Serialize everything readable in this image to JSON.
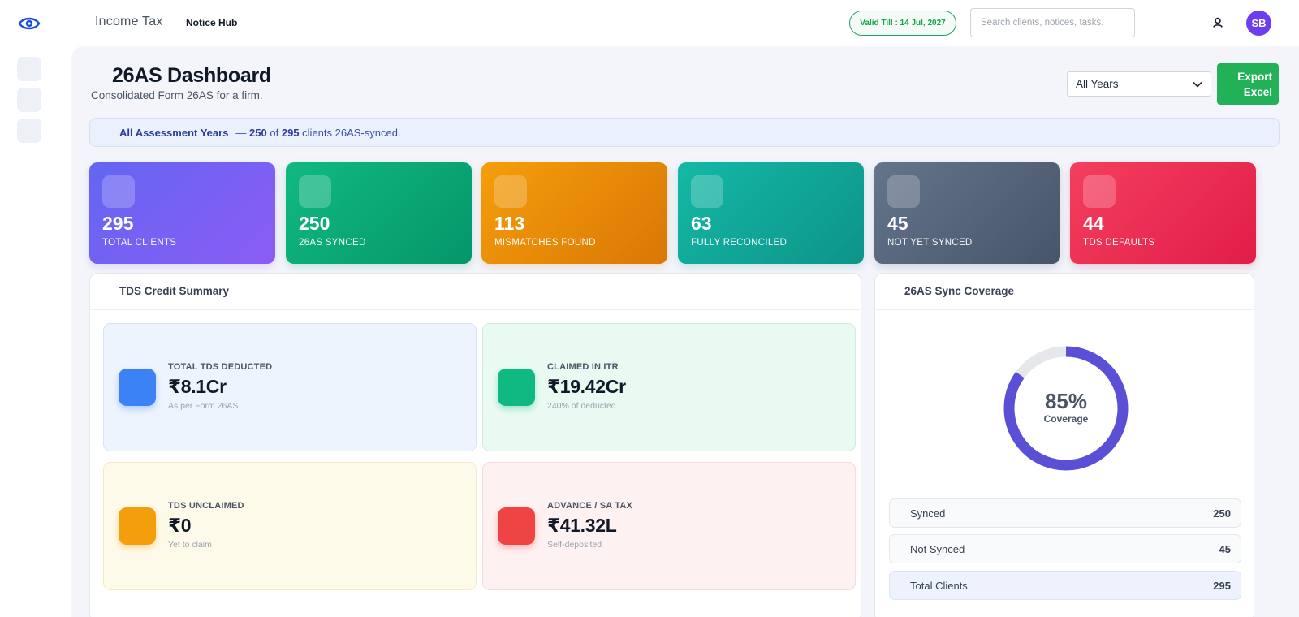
{
  "header": {
    "brand": "Income Tax",
    "nav_link": "Notice Hub",
    "valid_till": "Valid Till : 14 Jul, 2027",
    "search_placeholder": "Search clients, notices, tasks.",
    "avatar_initials": "SB"
  },
  "page": {
    "title": "26AS Dashboard",
    "subtitle": "Consolidated Form 26AS for a firm.",
    "year_filter": "All Years",
    "export_label_line1": "Export",
    "export_label_line2": "Excel"
  },
  "banner": {
    "label": "All Assessment Years",
    "dash": "—",
    "synced": "250",
    "of_text": "of",
    "total": "295",
    "suffix": "clients 26AS-synced."
  },
  "stats": [
    {
      "value": "295",
      "label": "TOTAL CLIENTS",
      "color_from": "#6366f1",
      "color_to": "#8b5cf6"
    },
    {
      "value": "250",
      "label": "26AS SYNCED",
      "color_from": "#10b981",
      "color_to": "#059669"
    },
    {
      "value": "113",
      "label": "MISMATCHES FOUND",
      "color_from": "#f59e0b",
      "color_to": "#d97706"
    },
    {
      "value": "63",
      "label": "FULLY RECONCILED",
      "color_from": "#14b8a6",
      "color_to": "#0d9488"
    },
    {
      "value": "45",
      "label": "NOT YET SYNCED",
      "color_from": "#64748b",
      "color_to": "#475569"
    },
    {
      "value": "44",
      "label": "TDS DEFAULTS",
      "color_from": "#f43f5e",
      "color_to": "#e11d48"
    }
  ],
  "tds_summary": {
    "title": "TDS Credit Summary",
    "cards": [
      {
        "label": "TOTAL TDS DEDUCTED",
        "value": "₹8.1Cr",
        "sub": "As per Form 26AS",
        "icon_color": "#3b82f6",
        "bg": "#eef4fd",
        "border": "#d6e4f7"
      },
      {
        "label": "CLAIMED IN ITR",
        "value": "₹19.42Cr",
        "sub": "240% of deducted",
        "icon_color": "#10b981",
        "bg": "#e9faf2",
        "border": "#cdeedd"
      },
      {
        "label": "TDS UNCLAIMED",
        "value": "₹0",
        "sub": "Yet to claim",
        "icon_color": "#f59e0b",
        "bg": "#fefaea",
        "border": "#f6ecc3"
      },
      {
        "label": "ADVANCE / SA TAX",
        "value": "₹41.32L",
        "sub": "Self-deposited",
        "icon_color": "#ef4444",
        "bg": "#fef1f1",
        "border": "#f7d9d9"
      }
    ]
  },
  "coverage": {
    "title": "26AS Sync Coverage",
    "percent_text": "85%",
    "percent_value": 85,
    "caption": "Coverage",
    "ring_color": "#5b4fd6",
    "track_color": "#e5e7eb",
    "rows": [
      {
        "label": "Synced",
        "value": "250"
      },
      {
        "label": "Not Synced",
        "value": "45"
      },
      {
        "label": "Total Clients",
        "value": "295"
      }
    ]
  }
}
